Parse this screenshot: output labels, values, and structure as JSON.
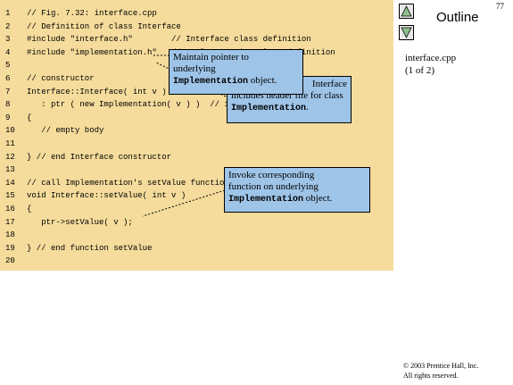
{
  "page_number": "77",
  "outline": {
    "title": "Outline",
    "file_name": "interface.cpp",
    "page_of": "(1 of 2)"
  },
  "code_lines": [
    {
      "num": "1",
      "text": "// Fig. 7.32: interface.cpp"
    },
    {
      "num": "2",
      "text": "// Definition of class Interface"
    },
    {
      "num": "3",
      "text": "#include \"interface.h\"        // Interface class definition"
    },
    {
      "num": "4",
      "text": "#include \"implementation.h\"   // Implementation class definition"
    },
    {
      "num": "5",
      "text": ""
    },
    {
      "num": "6",
      "text": "// constructor"
    },
    {
      "num": "7",
      "text": "Interface::Interface( int v )"
    },
    {
      "num": "8",
      "text": "   : ptr ( new Implementation( v ) )  // initialize ptr"
    },
    {
      "num": "9",
      "text": "{"
    },
    {
      "num": "10",
      "text": "   // empty body"
    },
    {
      "num": "11",
      "text": ""
    },
    {
      "num": "12",
      "text": "} // end Interface constructor"
    },
    {
      "num": "13",
      "text": ""
    },
    {
      "num": "14",
      "text": "// call Implementation's setValue function"
    },
    {
      "num": "15",
      "text": "void Interface::setValue( int v )"
    },
    {
      "num": "16",
      "text": "{"
    },
    {
      "num": "17",
      "text": "   ptr->setValue( v );"
    },
    {
      "num": "18",
      "text": ""
    },
    {
      "num": "19",
      "text": "} // end function setValue"
    },
    {
      "num": "20",
      "text": ""
    }
  ],
  "callouts": {
    "pointer": {
      "line1": "Maintain pointer to",
      "line2": "underlying",
      "mono": "Implementation",
      "tail": " object."
    },
    "header": {
      "line1_visible": "Interface",
      "line2": "includes header file for class",
      "mono": "Implementation",
      "tail": "."
    },
    "invoke": {
      "line1": "Invoke corresponding",
      "line2": "function on underlying",
      "mono": "Implementation",
      "tail": " object."
    }
  },
  "copyright": {
    "line1": "© 2003 Prentice Hall, Inc.",
    "line2": "All rights reserved."
  },
  "colors": {
    "code_bg": "#f5dc9c",
    "callout_bg": "#9ec4e8"
  }
}
